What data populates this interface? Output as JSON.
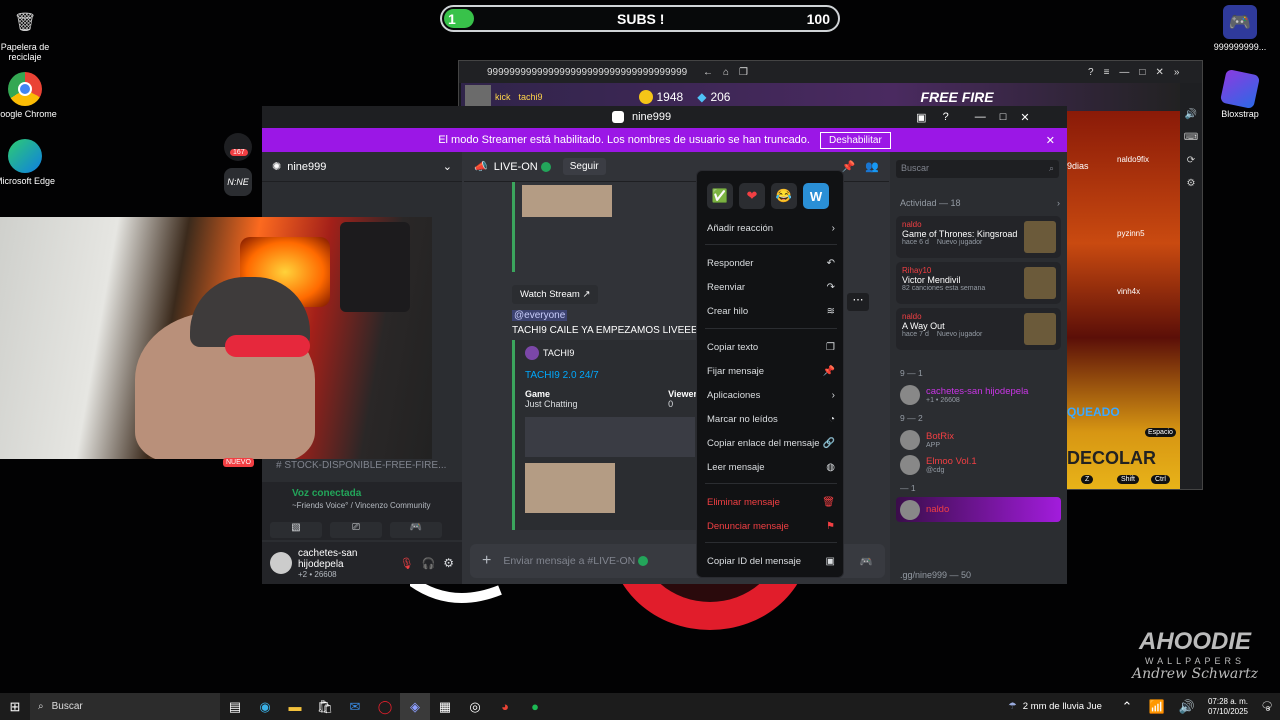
{
  "desktop": {
    "icons": [
      {
        "label": "Papelera de reciclaje",
        "icon": "recycle-bin-icon"
      },
      {
        "label": "Google Chrome",
        "icon": "chrome-icon"
      },
      {
        "label": "Microsoft Edge",
        "icon": "edge-icon"
      },
      {
        "label": "Bloxstrap",
        "icon": "bloxstrap-icon"
      },
      {
        "label": "999999999...",
        "icon": "game-controller-icon"
      }
    ],
    "watermark_title": "AHOODIE",
    "watermark_sub": "WALLPAPERS",
    "watermark_sig": "Andrew Schwartz"
  },
  "subs_bar": {
    "current": "1",
    "label": "SUBS !",
    "goal": "100",
    "progress": 0.04
  },
  "emulator": {
    "title": "99999999999999999999999999999999999999",
    "player_tag": "kick",
    "player_name": "tachi9",
    "coins": "1948",
    "diamonds": "206",
    "game_logo": "FREE FIRE",
    "labels": {
      "dias": "9dias",
      "naldo": "naldo9fix",
      "pyzinn": "pyzinn5",
      "vinh": "vinh4x",
      "queado": "QUEADO",
      "espacio": "Espacio",
      "decolar": "DECOLAR",
      "shift": "Shift",
      "ctrl": "Ctrl",
      "z": "Z"
    }
  },
  "discord": {
    "window_title": "nine999",
    "streamer_banner": "El modo Streamer está habilitado. Los nombres de usuario se han truncado.",
    "disable_button": "Deshabilitar",
    "server_name": "nine999",
    "server_badge": "167",
    "channel_name": "LIVE-ON",
    "follow_button": "Seguir",
    "search_placeholder": "Buscar",
    "watch_stream": "Watch Stream",
    "mention": "@everyone",
    "message_text": "TACHI9 CAILE YA EMPEZAMOS LIVEEE!",
    "embed_author": "TACHI9",
    "embed_title": "TACHI9 2.0 24/7",
    "embed_field_game_label": "Game",
    "embed_field_game_value": "Just Chatting",
    "embed_field_viewers_label": "Viewers",
    "embed_field_viewers_value": "0",
    "new_badge": "NUEVO",
    "channel_stock": "STOCK-DISPONIBLE-FREE-FIRE...",
    "voice_status": "Voz conectada",
    "voice_channel": "~Friends Voice° / Vincenzo Community",
    "user_name": "cachetes-san hijodepela",
    "user_sub": "+2 • 26608",
    "composer_placeholder": "Enviar mensaje a #LIVE-ON",
    "activity_header": "Actividad — 18",
    "activity": [
      {
        "user": "naldo",
        "title": "Game of Thrones: Kingsroad",
        "meta": "hace 6 d",
        "tag": "Nuevo jugador"
      },
      {
        "user": "Rihay10",
        "title": "Victor Mendivil",
        "meta": "82 canciones esta semana",
        "tag": ""
      },
      {
        "user": "naldo",
        "title": "A Way Out",
        "meta": "hace 7 d",
        "tag": "Nuevo jugador"
      }
    ],
    "member_groups": [
      {
        "header": "9 — 1",
        "members": [
          {
            "name": "cachetes-san hijodepela",
            "sub": "+1 • 26608"
          }
        ]
      },
      {
        "header": "9 — 2",
        "members": [
          {
            "name": "BotRix",
            "sub": "APP"
          },
          {
            "name": "Elmoo Vol.1",
            "sub": "@cdg",
            "badge": "#1"
          }
        ]
      },
      {
        "header": "— 1",
        "members": [
          {
            "name": "naldo",
            "sub": ""
          }
        ]
      }
    ],
    "invite": ".gg/nine999 — 50"
  },
  "context_menu": {
    "reactions": [
      "✅",
      "❤",
      "😂",
      "W"
    ],
    "items": [
      {
        "label": "Añadir reacción",
        "icon": "chevron-right-icon",
        "danger": false
      },
      {
        "label": "Responder",
        "icon": "reply-icon",
        "danger": false
      },
      {
        "label": "Reenviar",
        "icon": "forward-icon",
        "danger": false
      },
      {
        "label": "Crear hilo",
        "icon": "thread-icon",
        "danger": false
      },
      {
        "label": "Copiar texto",
        "icon": "copy-icon",
        "danger": false
      },
      {
        "label": "Fijar mensaje",
        "icon": "pin-icon",
        "danger": false
      },
      {
        "label": "Aplicaciones",
        "icon": "chevron-right-icon",
        "danger": false
      },
      {
        "label": "Marcar no leídos",
        "icon": "unread-icon",
        "danger": false
      },
      {
        "label": "Copiar enlace del mensaje",
        "icon": "link-icon",
        "danger": false
      },
      {
        "label": "Leer mensaje",
        "icon": "speaker-icon",
        "danger": false
      },
      {
        "label": "Eliminar mensaje",
        "icon": "trash-icon",
        "danger": true
      },
      {
        "label": "Denunciar mensaje",
        "icon": "flag-icon",
        "danger": true
      },
      {
        "label": "Copiar ID del mensaje",
        "icon": "id-icon",
        "danger": false
      }
    ]
  },
  "taskbar": {
    "search": "Buscar",
    "weather": "2 mm de lluvia Jue",
    "time": "07:28 a. m.",
    "date": "07/10/2025",
    "notifications": "8"
  }
}
